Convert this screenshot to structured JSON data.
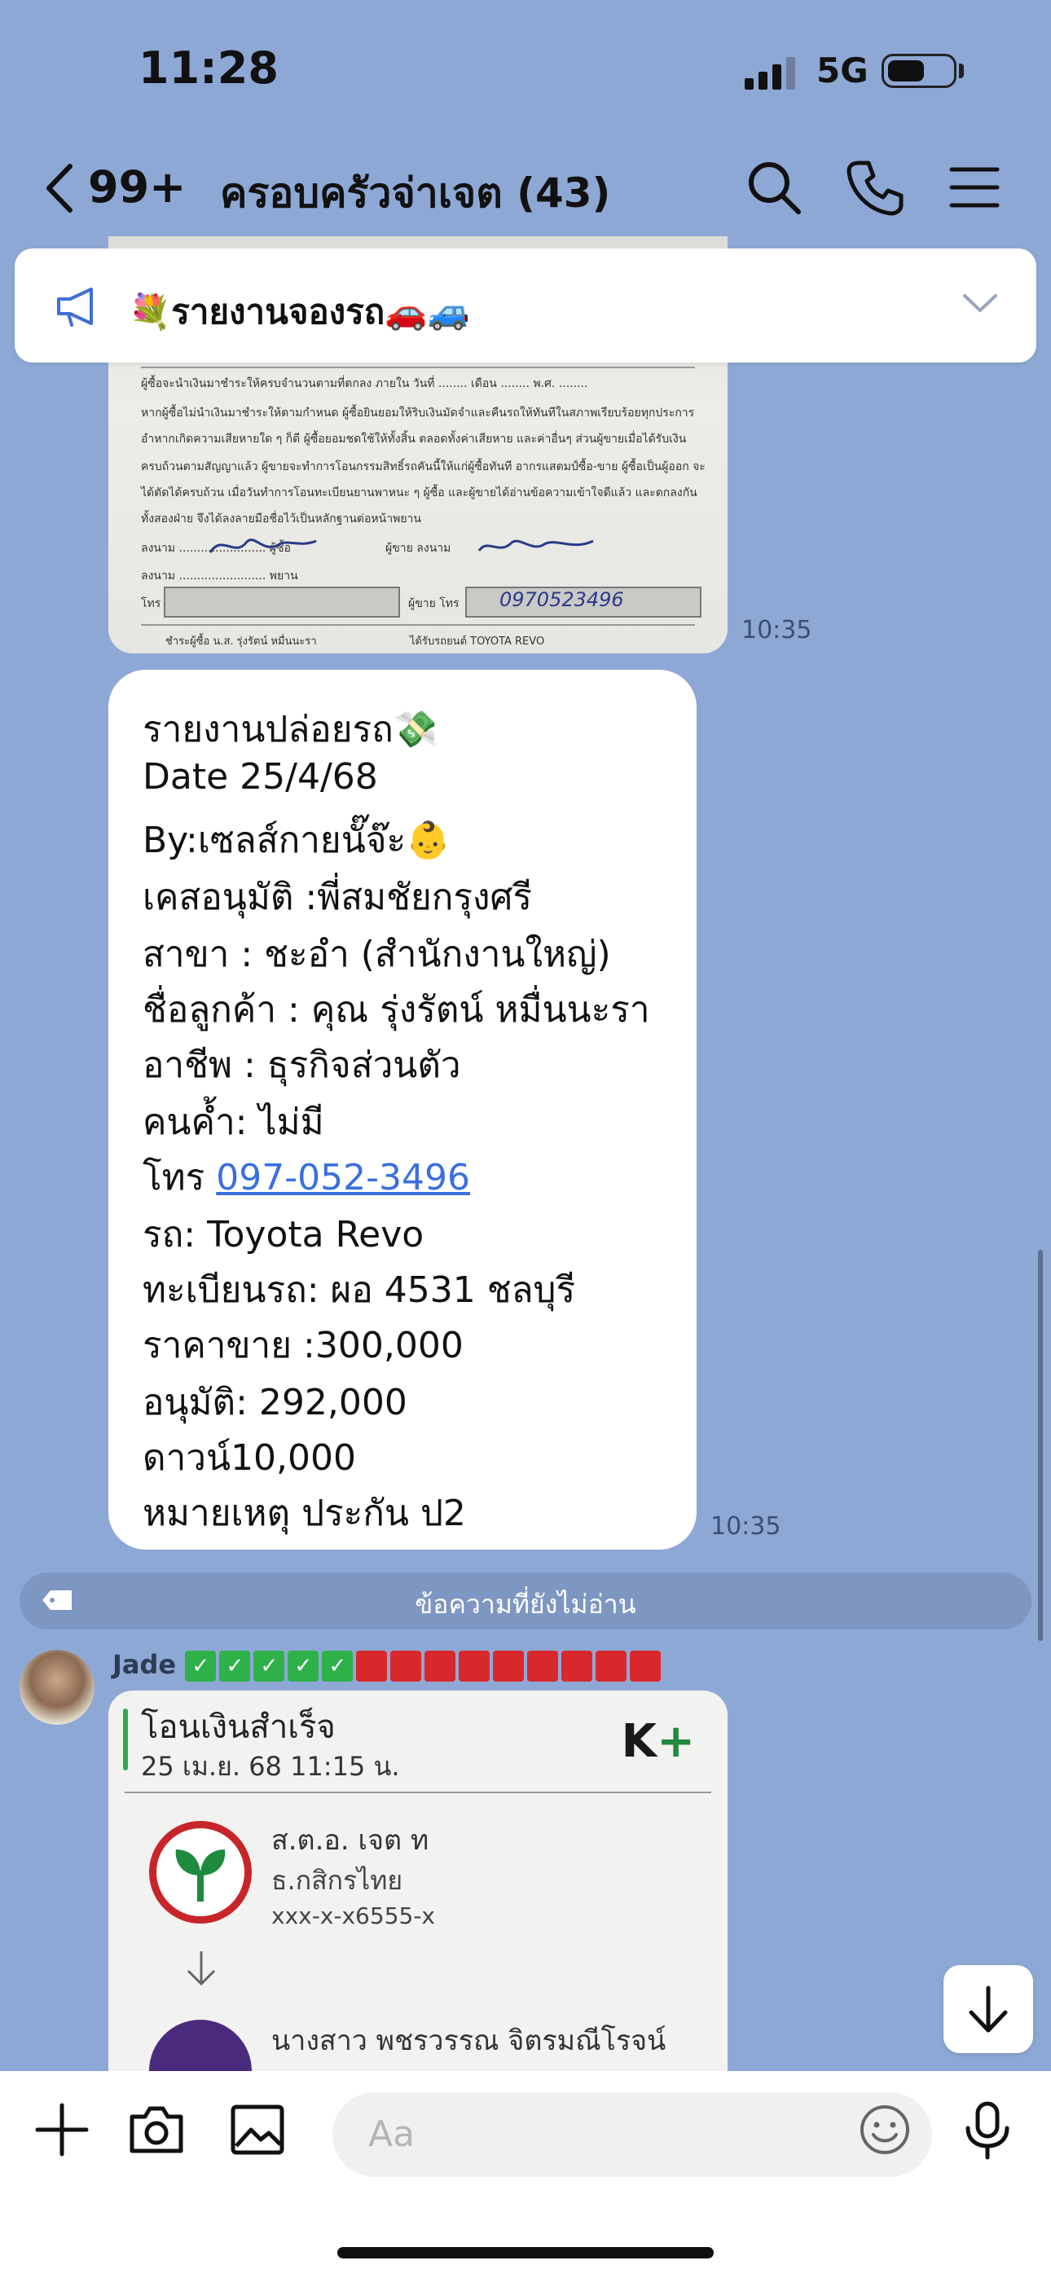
{
  "status_bar": {
    "time": "11:28",
    "network": "5G"
  },
  "header": {
    "back_count": "99+",
    "title": "ครอบครัวจ่าเจต (43)"
  },
  "announcement": {
    "text": "💐รายงานจองรถ🚗🚙"
  },
  "messages": {
    "doc_image": {
      "time": "10:35",
      "text_lines": [
        "ผู้ซื้อจะนำเงินมาชำระให้ครบจำนวนตามที่ตกลง ภายใน วันที่ ........ เดือน ........ พ.ศ. ........",
        "หากผู้ซื้อไม่นำเงินมาชำระให้ตามกำหนด ผู้ซื้อยินยอมให้ริบเงินมัดจำและคืนรถให้ทันทีในสภาพเรียบร้อยทุกประการ",
        "อำหากเกิดความเสียหายใด ๆ ก็ดี ผู้ซื้อยอมชดใช้ให้ทั้งสิ้น ตลอดทั้งค่าเสียหาย และค่าอื่นๆ ส่วนผู้ขายเมื่อได้รับเงิน",
        "ครบถ้วนตามสัญญาแล้ว ผู้ขายจะทำการโอนกรรมสิทธิ์รถคันนี้ให้แก่ผู้ซื้อทันที อากรแสตมป์ซื้อ-ขาย ผู้ซื้อเป็นผู้ออก จะ",
        "ได้ตัดได้ครบถ้วน เมื่อวันทำการโอนทะเบียนยานพาหนะ ๆ ผู้ซื้อ และผู้ขายได้อ่านข้อความเข้าใจดีแล้ว และตกลงกัน",
        "ทั้งสองฝ่าย จึงได้ลงลายมือชื่อไว้เป็นหลักฐานต่อหน้าพยาน"
      ],
      "sig_buyer": "ลงนาม ........................ ผู้ซื้อ",
      "sig_seller": "ผู้ขาย ลงนาม",
      "witness_1": "ลงนาม ........................ พยาน",
      "phone_label": "โทร",
      "seller_phone_label": "ผู้ขาย โทร",
      "handwritten_phone": "0970523496",
      "bottom_left": "ชำระผู้ซื้อ น.ส. รุ่งรัตน์ หมื่นนะรา",
      "bottom_right": "ได้รับรถยนต์ TOYOTA REVO"
    },
    "release_report": {
      "time": "10:35",
      "lines": [
        "รายงานปล่อยรถ💸",
        "Date 25/4/68",
        "By:เซลส์กายนั๊จ๊ะ👶",
        "เคสอนุมัติ :พี่สมชัยกรุงศรี",
        "สาขา : ชะอำ (สำนักงานใหญ่)",
        "ชื่อลูกค้า : คุณ  รุ่งรัตน์ หมื่นนะรา",
        "อาชีพ : ธุรกิจส่วนตัว",
        "คนค้ำ: ไม่มี"
      ],
      "phone_label": "โทร ",
      "phone": "097-052-3496",
      "lines_after": [
        "รถ: Toyota Revo",
        "ทะเบียนรถ: ผอ 4531 ชลบุรี",
        "ราคาขาย :300,000",
        "อนุมัติ: 292,000",
        "ดาวน์10,000",
        "หมายเหตุ ประกัน ป2"
      ]
    },
    "unread_divider": "ข้อความที่ยังไม่อ่าน",
    "sender": {
      "name": "Jade",
      "green_marks": 5,
      "red_marks": 9
    },
    "slip": {
      "title": "โอนเงินสำเร็จ",
      "datetime": "25 เม.ย. 68  11:15 น.",
      "brand": "K",
      "brand_plus": "+",
      "from_name": "ส.ต.อ. เจต ท",
      "from_bank": "ธ.กสิกรไทย",
      "from_account": "xxx-x-x6555-x",
      "to_name": "นางสาว พชรวรรณ จิตรมณีโรจน์"
    }
  },
  "composer": {
    "placeholder": "Aa"
  }
}
